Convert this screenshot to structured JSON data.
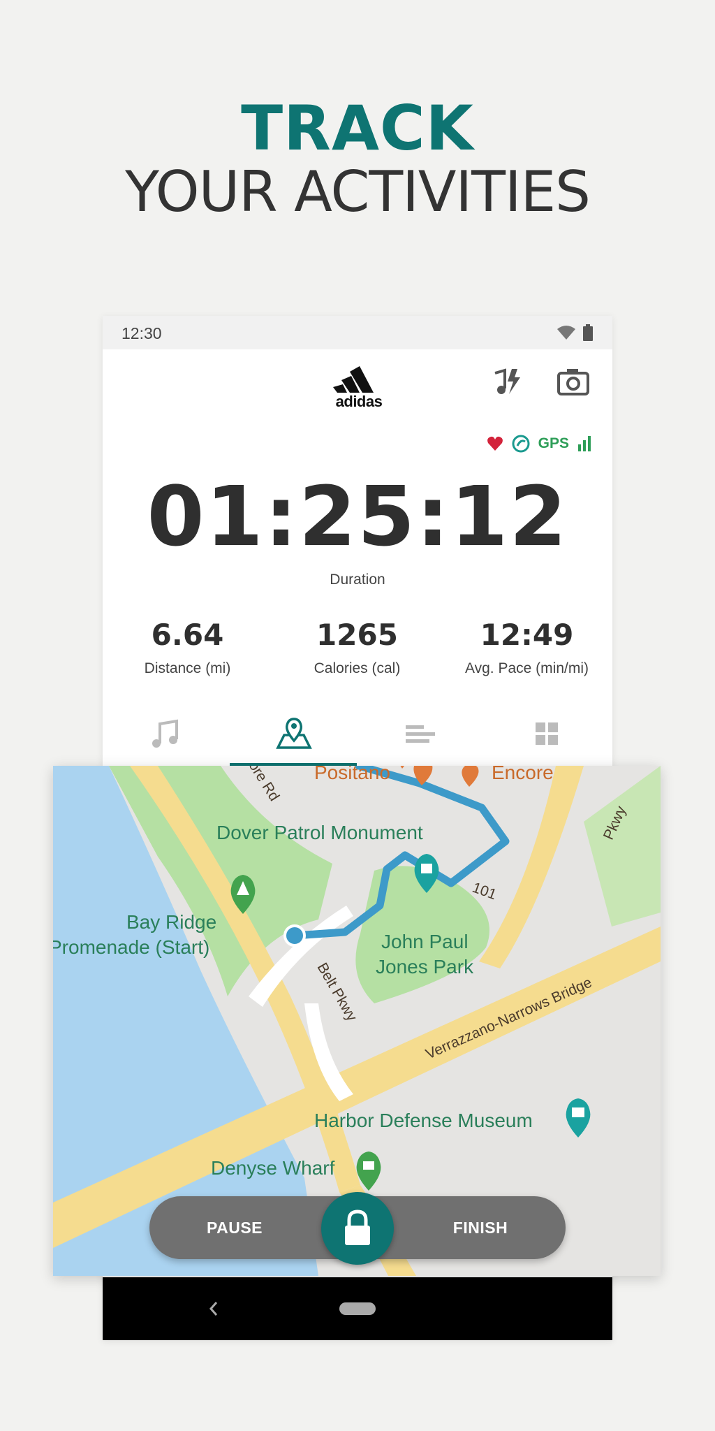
{
  "headline": {
    "line1": "TRACK",
    "line2": "YOUR ACTIVITIES"
  },
  "status_bar": {
    "time": "12:30"
  },
  "app": {
    "brand": "adidas",
    "indicators": {
      "gps_label": "GPS"
    },
    "timer": {
      "value": "01:25:12",
      "label": "Duration"
    },
    "stats": [
      {
        "value": "6.64",
        "label": "Distance (mi)"
      },
      {
        "value": "1265",
        "label": "Calories (cal)"
      },
      {
        "value": "12:49",
        "label": "Avg. Pace (min/mi)"
      }
    ],
    "tabs": [
      {
        "icon": "music-note-icon"
      },
      {
        "icon": "map-pin-icon",
        "active": true
      },
      {
        "icon": "bars-icon"
      },
      {
        "icon": "grid-icon"
      }
    ]
  },
  "map": {
    "labels": {
      "positano": "Positano",
      "encore": "Encore",
      "dover": "Dover Patrol Monument",
      "bay_ridge_1": "Bay Ridge",
      "bay_ridge_2": "Promenade (Start)",
      "john_paul_1": "John Paul",
      "john_paul_2": "Jones Park",
      "belt_pkwy": "Belt Pkwy",
      "verrazzano": "Verrazzano-Narrows Bridge",
      "harbor": "Harbor Defense Museum",
      "denyse": "Denyse Wharf",
      "pkwy": "Pkwy",
      "shore_rd": "ore Rd",
      "route_101": "101"
    }
  },
  "controls": {
    "pause": "PAUSE",
    "finish": "FINISH"
  },
  "colors": {
    "accent": "#0e7472",
    "route": "#3d9ac9",
    "water": "#aad3f0",
    "park": "#b5e0a3",
    "road": "#f5dc8f"
  }
}
